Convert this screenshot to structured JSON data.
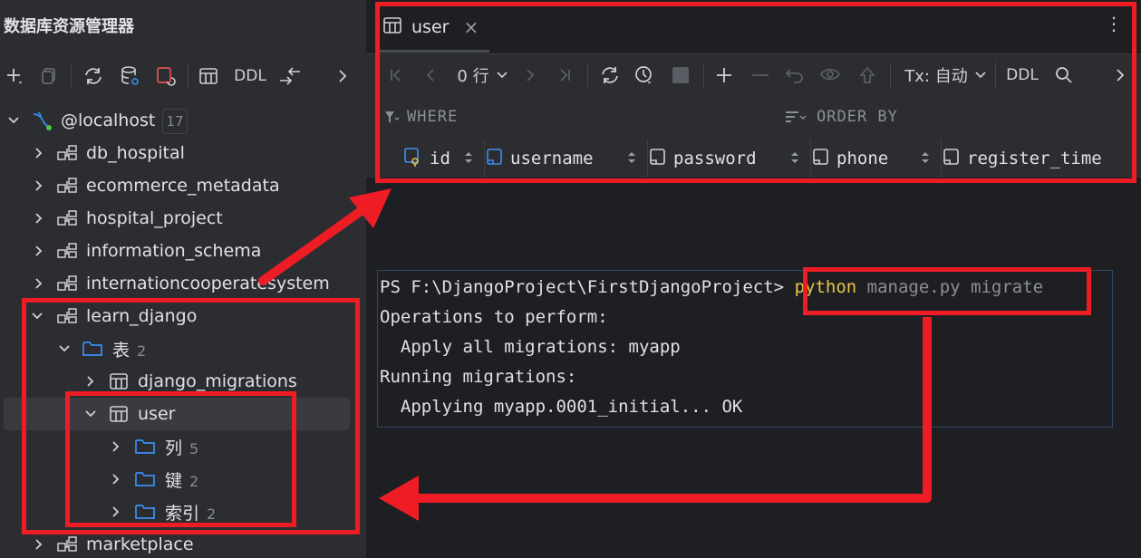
{
  "left_panel": {
    "title": "数据库资源管理器",
    "toolbar": {
      "add_icon": "plus-icon",
      "copy_icon": "copy-icon",
      "refresh_icon": "refresh-icon",
      "db_settings_icon": "database-gear-icon",
      "stop_icon": "stop-refresh-icon",
      "table_icon": "table-icon",
      "ddl_label": "DDL",
      "jump_icon": "jump-to-icon",
      "more_icon": "chevron-right-icon"
    },
    "tree": {
      "connection": {
        "label": "@localhost",
        "count": "17"
      },
      "databases": [
        {
          "label": "db_hospital"
        },
        {
          "label": "ecommerce_metadata"
        },
        {
          "label": "hospital_project"
        },
        {
          "label": "information_schema"
        },
        {
          "label": "internationcooperatesystem"
        },
        {
          "label": "learn_django"
        }
      ],
      "tables_folder": {
        "label": "表",
        "count": "2"
      },
      "tables": [
        {
          "label": "django_migrations"
        },
        {
          "label": "user"
        }
      ],
      "user_children": [
        {
          "label": "列",
          "count": "5"
        },
        {
          "label": "键",
          "count": "2"
        },
        {
          "label": "索引",
          "count": "2"
        }
      ],
      "last_database": {
        "label": "marketplace"
      }
    }
  },
  "editor": {
    "tab": {
      "label": "user",
      "close": "×"
    },
    "toolbar": {
      "rows_label": "0 行",
      "tx_label": "Tx: 自动",
      "ddl_label": "DDL"
    },
    "filter": {
      "where": "WHERE",
      "order_by": "ORDER BY"
    },
    "columns": [
      "id",
      "username",
      "password",
      "phone",
      "register_time"
    ]
  },
  "terminal": {
    "prompt": "PS F:\\DjangoProject\\FirstDjangoProject> ",
    "command_keyword": "python",
    "command_args": " manage.py migrate",
    "lines": [
      "Operations to perform:",
      "  Apply all migrations: myapp",
      "Running migrations:",
      "  Applying myapp.0001_initial... OK"
    ]
  },
  "colors": {
    "annotation": "#ee1c25",
    "keyword": "#e8c547",
    "background": "#1e1f22",
    "panel": "#2b2d30"
  }
}
